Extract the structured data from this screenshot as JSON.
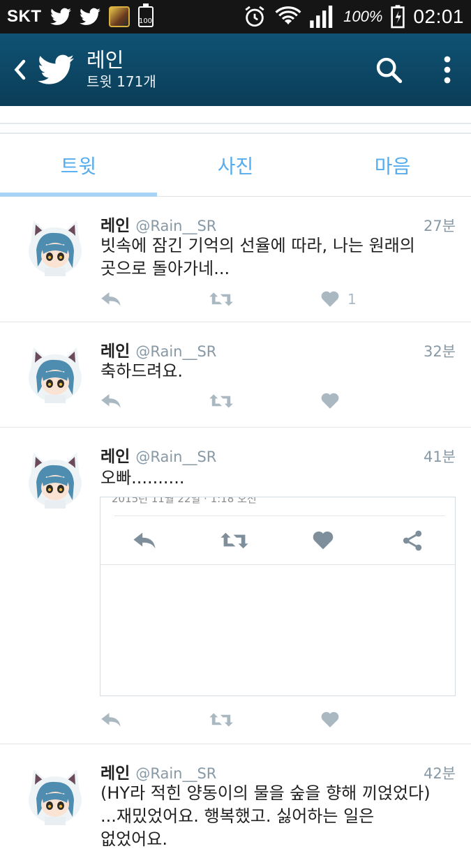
{
  "status_bar": {
    "carrier": "SKT",
    "battery_small_label": "100",
    "battery_percent": "100%",
    "time": "02:01"
  },
  "app_bar": {
    "title": "레인",
    "subtitle": "트윗 171개"
  },
  "tabs": [
    {
      "label": "트윗",
      "active": true
    },
    {
      "label": "사진",
      "active": false
    },
    {
      "label": "마음",
      "active": false
    }
  ],
  "tweets": [
    {
      "name": "레인",
      "handle": "@Rain__SR",
      "time": "27분",
      "text_lines": [
        "빗속에 잠긴 기억의 선율에 따라, 나는 원래의",
        "곳으로 돌아가네..."
      ],
      "like_count": "1"
    },
    {
      "name": "레인",
      "handle": "@Rain__SR",
      "time": "32분",
      "text_lines": [
        "축하드려요."
      ],
      "like_count": ""
    },
    {
      "name": "레인",
      "handle": "@Rain__SR",
      "time": "41분",
      "text_lines": [
        "오빠.........."
      ],
      "like_count": "",
      "card": {
        "date": "2015년 11월 22일 · 1:18 오전"
      }
    },
    {
      "name": "레인",
      "handle": "@Rain__SR",
      "time": "42분",
      "text_lines": [
        "(HY라 적힌 양동이의 물을 숲을 향해 끼얹었다)",
        "...재밌었어요. 행복했고. 싫어하는 일은",
        "없었어요."
      ],
      "like_count": ""
    }
  ],
  "colors": {
    "app_bar": "#0b4a6a",
    "accent_blue": "#55acee",
    "icon_gray": "#aab8c2"
  }
}
